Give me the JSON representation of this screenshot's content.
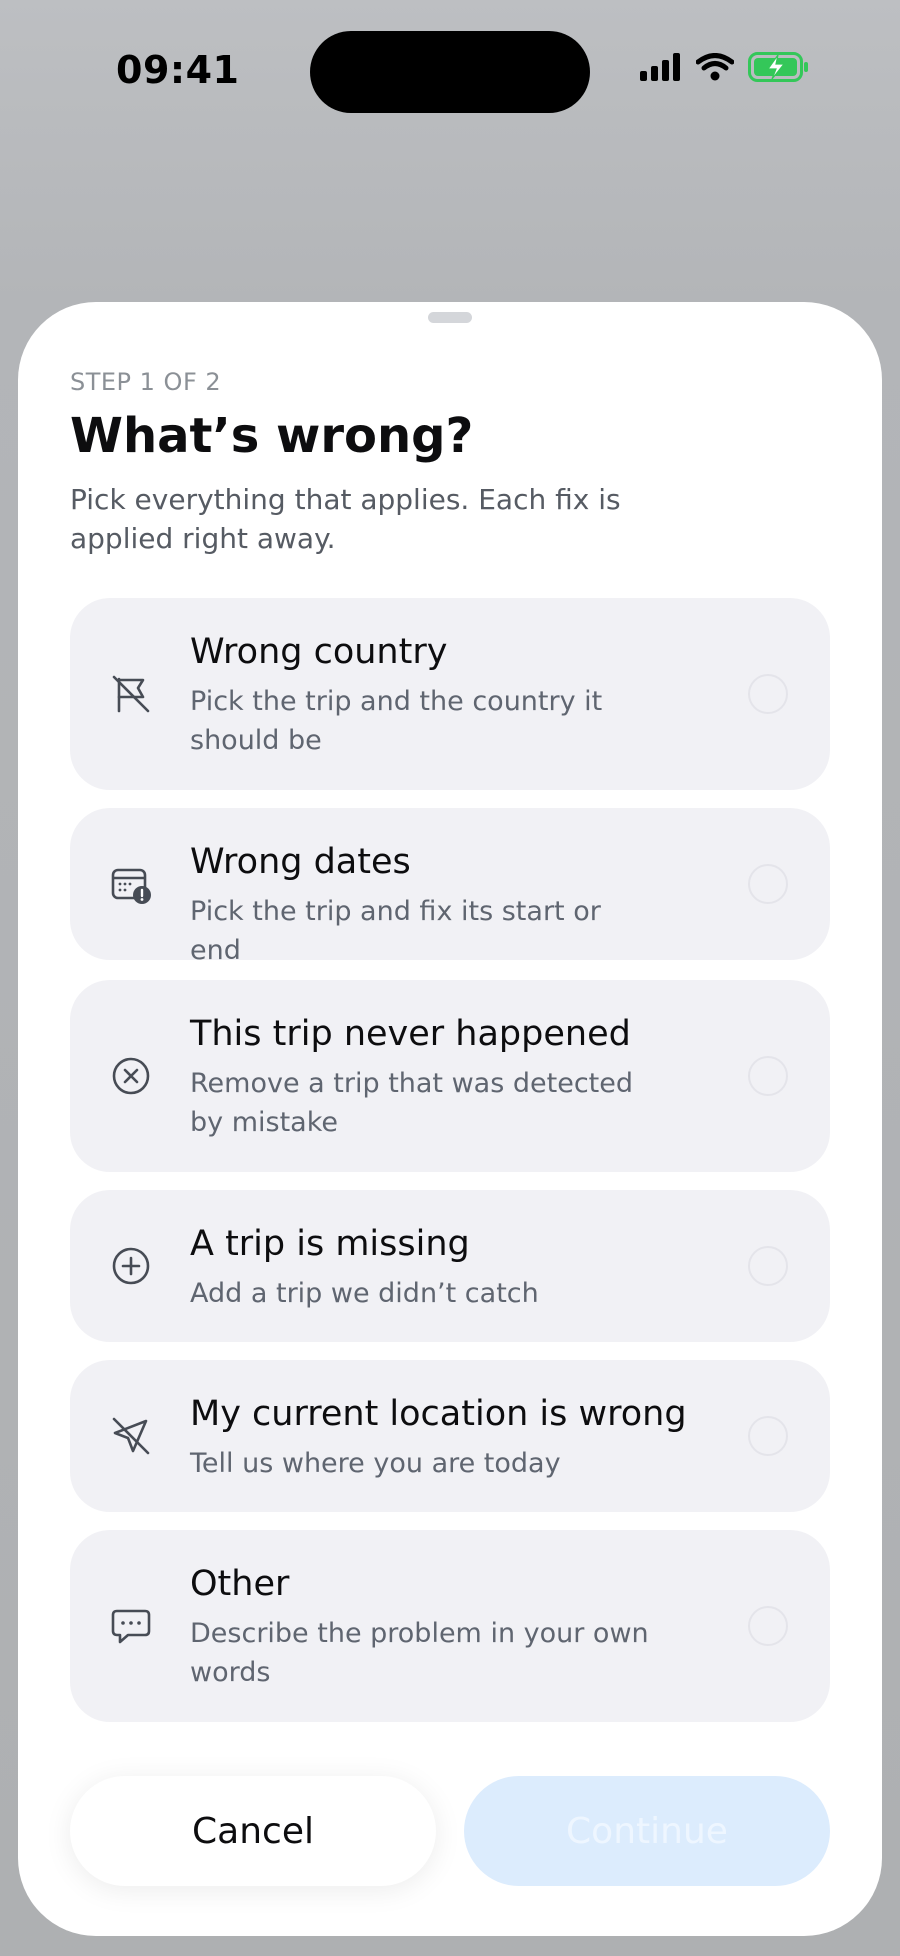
{
  "status": {
    "time": "09:41",
    "battery_color": "#34c759"
  },
  "sheet": {
    "step": "STEP 1 OF 2",
    "title": "What’s wrong?",
    "subtitle": "Pick everything that applies. Each fix is applied right away."
  },
  "options": [
    {
      "title": "Wrong country",
      "desc": "Pick the trip and the country it should be",
      "icon": "flag-off-icon",
      "selected": false
    },
    {
      "title": "Wrong dates",
      "desc": "Pick the trip and fix its start or end",
      "icon": "calendar-alert-icon",
      "selected": false
    },
    {
      "title": "This trip never happened",
      "desc": "Remove a trip that was detected by mistake",
      "icon": "circle-x-icon",
      "selected": false
    },
    {
      "title": "A trip is missing",
      "desc": "Add a trip we didn’t catch",
      "icon": "circle-plus-icon",
      "selected": false
    },
    {
      "title": "My current location is wrong",
      "desc": "Tell us where you are today",
      "icon": "location-off-icon",
      "selected": false
    },
    {
      "title": "Other",
      "desc": "Describe the problem in your own words",
      "icon": "chat-bubble-icon",
      "selected": false
    }
  ],
  "actions": {
    "cancel_label": "Cancel",
    "continue_label": "Continue",
    "continue_enabled": false,
    "accent_color": "#dcecfd"
  }
}
